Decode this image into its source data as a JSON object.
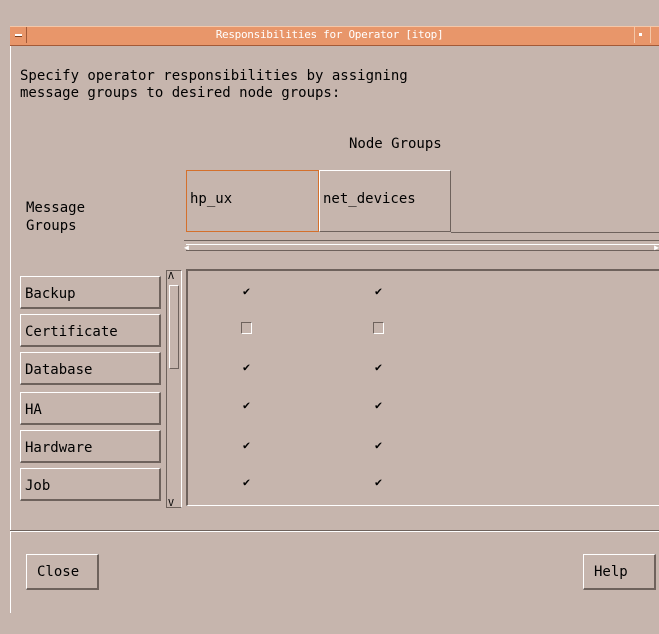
{
  "window": {
    "title": "Responsibilities for Operator  [itop]"
  },
  "instructions": {
    "line1": "Specify operator responsibilities by assigning",
    "line2": "message groups to desired node groups:"
  },
  "node_groups_label": "Node Groups",
  "message_groups_label": {
    "line1": "Message",
    "line2": "Groups"
  },
  "columns": [
    {
      "label": "hp_ux",
      "active": true
    },
    {
      "label": "net_devices",
      "active": false
    }
  ],
  "rows": [
    {
      "label": "Backup",
      "checks": [
        true,
        true
      ]
    },
    {
      "label": "Certificate",
      "checks": [
        false,
        false
      ]
    },
    {
      "label": "Database",
      "checks": [
        true,
        true
      ]
    },
    {
      "label": "HA",
      "checks": [
        true,
        true
      ]
    },
    {
      "label": "Hardware",
      "checks": [
        true,
        true
      ]
    },
    {
      "label": "Job",
      "checks": [
        true,
        true
      ]
    }
  ],
  "buttons": {
    "close": "Close",
    "help": "Help"
  },
  "colors": {
    "title_bar": "#e8966a",
    "background": "#c6b5ad",
    "active_column_border": "#d4702c"
  },
  "icons": {
    "window_menu": "window-menu-icon",
    "maximize": "maximize-icon",
    "check": "check-icon",
    "scroll_up": "arrow-up-icon",
    "scroll_down": "arrow-down-icon",
    "scroll_left": "arrow-left-icon",
    "scroll_right": "arrow-right-icon"
  }
}
